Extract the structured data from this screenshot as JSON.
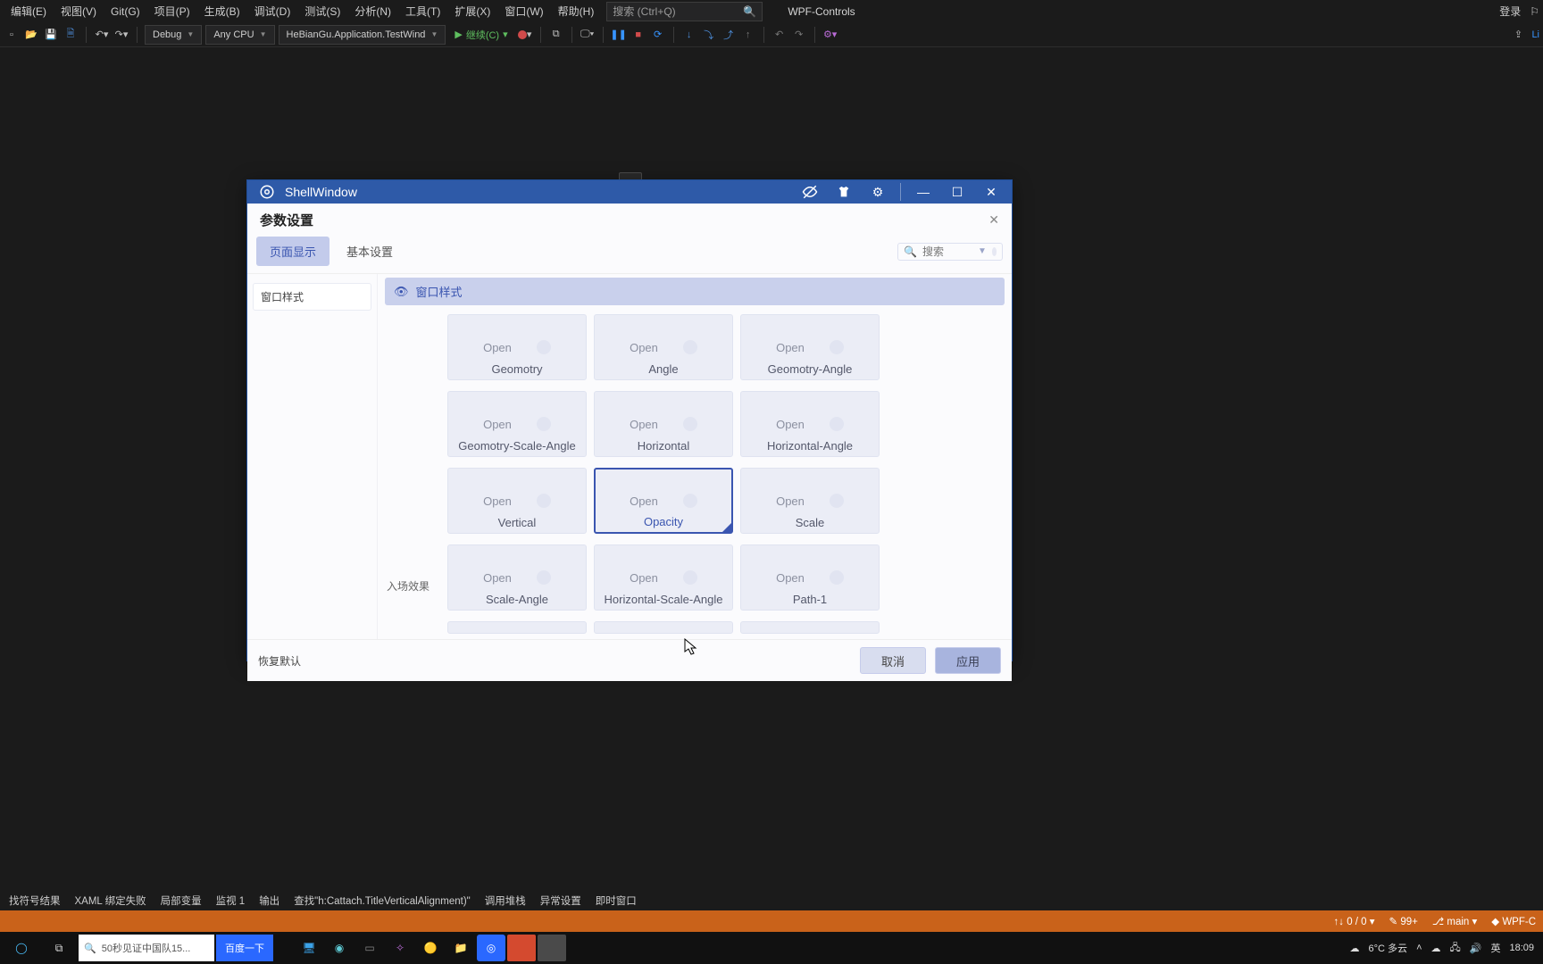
{
  "vs": {
    "menus": [
      "编辑(E)",
      "视图(V)",
      "Git(G)",
      "项目(P)",
      "生成(B)",
      "调试(D)",
      "测试(S)",
      "分析(N)",
      "工具(T)",
      "扩展(X)",
      "窗口(W)",
      "帮助(H)"
    ],
    "search_placeholder": "搜索 (Ctrl+Q)",
    "title": "WPF-Controls",
    "login": "登录",
    "toolbar": {
      "config": "Debug",
      "cpu": "Any CPU",
      "target": "HeBianGu.Application.TestWind",
      "continue": "继续(C)"
    },
    "panelTabs": [
      "找符号结果",
      "XAML 绑定失败",
      "局部变量",
      "监视 1",
      "输出",
      "查找\"h:Cattach.TitleVerticalAlignment)\"",
      "调用堆栈",
      "异常设置",
      "即时窗口"
    ],
    "status": {
      "counters": "0 / 0",
      "warn": "99+",
      "branch": "main",
      "project": "WPF-C"
    },
    "right_link": "Li"
  },
  "shell": {
    "title": "ShellWindow",
    "settings_title": "参数设置",
    "tabs": {
      "a": "页面显示",
      "b": "基本设置"
    },
    "search_placeholder": "搜索",
    "nav_item": "窗口样式",
    "section_title": "窗口样式",
    "open_label": "Open",
    "entrance_label": "入场效果",
    "cards": {
      "r1": [
        "Geomotry",
        "Angle",
        "Geomotry-Angle"
      ],
      "r2": [
        "Geomotry-Scale-Angle",
        "Horizontal",
        "Horizontal-Angle"
      ],
      "r3": [
        "Vertical",
        "Opacity",
        "Scale"
      ],
      "r4": [
        "Scale-Angle",
        "Horizontal-Scale-Angle",
        "Path-1"
      ]
    },
    "footer": {
      "restore": "恢复默认",
      "cancel": "取消",
      "apply": "应用"
    }
  },
  "taskbar": {
    "search_text": "50秒见证中国队15...",
    "baidu": "百度一下",
    "weather": "6°C 多云",
    "ime": "英",
    "time": "18:09"
  }
}
